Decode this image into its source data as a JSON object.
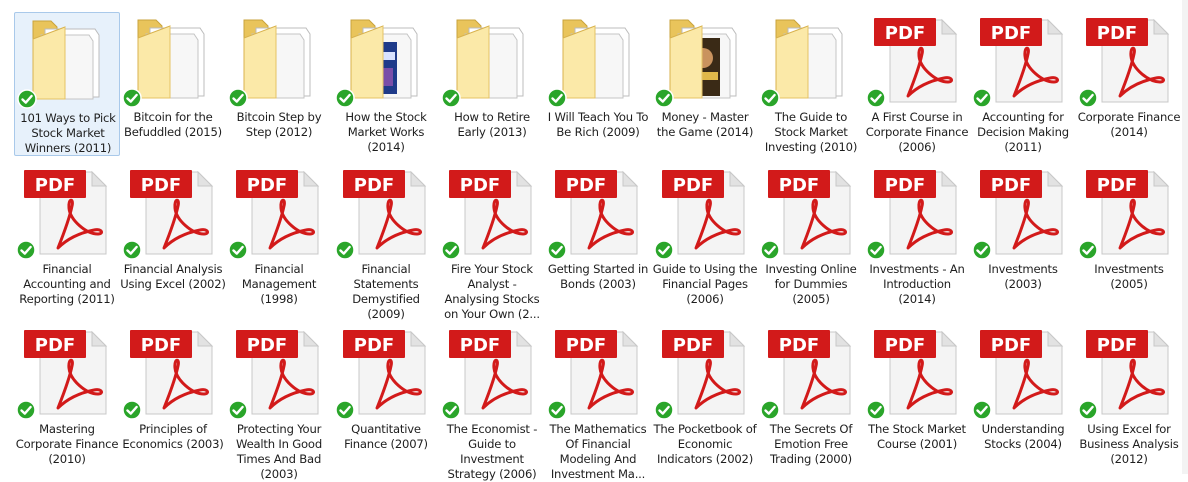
{
  "explorer": {
    "colors": {
      "folder_light": "#fbe9a8",
      "folder_dark": "#e9c45b",
      "pdf_red": "#d21a1a",
      "check_green": "#2aa52a",
      "selection": "#e7f1fb"
    },
    "items": [
      {
        "name": "101 Ways to Pick Stock Market Winners (2011)",
        "type": "folder",
        "synced": true,
        "selected": true
      },
      {
        "name": "Bitcoin for the Befuddled (2015)",
        "type": "folder",
        "synced": true
      },
      {
        "name": "Bitcoin Step by Step (2012)",
        "type": "folder",
        "synced": true
      },
      {
        "name": "How the Stock Market Works (2014)",
        "type": "folder-book",
        "synced": true
      },
      {
        "name": "How to Retire Early (2013)",
        "type": "folder",
        "synced": true
      },
      {
        "name": "I Will Teach You To Be Rich (2009)",
        "type": "folder",
        "synced": true
      },
      {
        "name": "Money - Master the Game (2014)",
        "type": "folder-photo",
        "synced": true
      },
      {
        "name": "The Guide to Stock Market Investing (2010)",
        "type": "folder",
        "synced": true
      },
      {
        "name": "A First Course in Corporate Finance (2006)",
        "type": "pdf",
        "synced": true
      },
      {
        "name": "Accounting for Decision Making (2011)",
        "type": "pdf",
        "synced": true
      },
      {
        "name": "Corporate Finance (2014)",
        "type": "pdf",
        "synced": true
      },
      {
        "name": "Financial Accounting and Reporting (2011)",
        "type": "pdf",
        "synced": true
      },
      {
        "name": "Financial Analysis Using Excel (2002)",
        "type": "pdf",
        "synced": true
      },
      {
        "name": "Financial Management (1998)",
        "type": "pdf",
        "synced": true
      },
      {
        "name": "Financial Statements Demystified (2009)",
        "type": "pdf",
        "synced": true
      },
      {
        "name": "Fire Your Stock Analyst - Analysing Stocks on Your Own (2...",
        "type": "pdf",
        "synced": true
      },
      {
        "name": "Getting Started in Bonds (2003)",
        "type": "pdf",
        "synced": true
      },
      {
        "name": "Guide to Using the Financial Pages (2006)",
        "type": "pdf",
        "synced": true
      },
      {
        "name": "Investing Online for Dummies (2005)",
        "type": "pdf",
        "synced": true
      },
      {
        "name": "Investments - An Introduction (2014)",
        "type": "pdf",
        "synced": true
      },
      {
        "name": "Investments (2003)",
        "type": "pdf",
        "synced": true
      },
      {
        "name": "Investments (2005)",
        "type": "pdf",
        "synced": true
      },
      {
        "name": "Mastering Corporate Finance (2010)",
        "type": "pdf",
        "synced": true
      },
      {
        "name": "Principles of Economics (2003)",
        "type": "pdf",
        "synced": true
      },
      {
        "name": "Protecting Your Wealth In Good Times And Bad (2003)",
        "type": "pdf",
        "synced": true
      },
      {
        "name": "Quantitative Finance (2007)",
        "type": "pdf",
        "synced": true
      },
      {
        "name": "The Economist - Guide to Investment Strategy (2006)",
        "type": "pdf",
        "synced": true
      },
      {
        "name": "The Mathematics Of Financial Modeling And Investment Ma...",
        "type": "pdf",
        "synced": true
      },
      {
        "name": "The Pocketbook of Economic Indicators (2002)",
        "type": "pdf",
        "synced": true
      },
      {
        "name": "The Secrets Of Emotion Free Trading (2000)",
        "type": "pdf",
        "synced": true
      },
      {
        "name": "The Stock Market Course (2001)",
        "type": "pdf",
        "synced": true
      },
      {
        "name": "Understanding Stocks (2004)",
        "type": "pdf",
        "synced": true
      },
      {
        "name": "Using Excel for Business Analysis (2012)",
        "type": "pdf",
        "synced": true
      }
    ]
  },
  "pdf_badge_text": "PDF"
}
